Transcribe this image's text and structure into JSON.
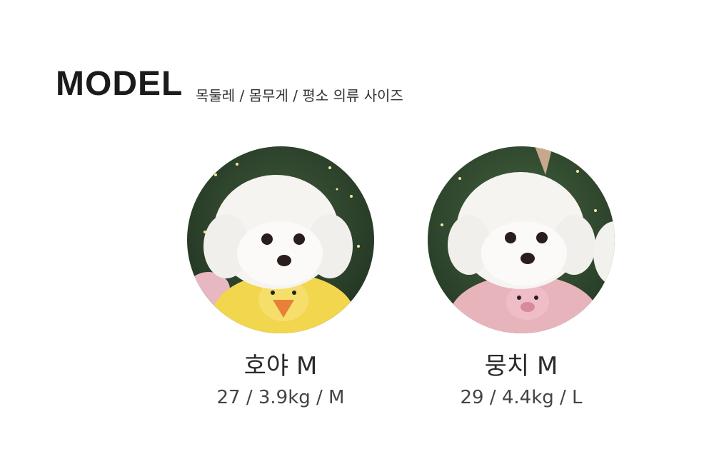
{
  "header": {
    "title": "MODEL",
    "subtitle": "목둘레  / 몸무게 / 평소 의류 사이즈"
  },
  "models": [
    {
      "name": "호야 M",
      "stats": "27 / 3.9kg / M",
      "outfit_color": "#f1d64e"
    },
    {
      "name": "뭉치 M",
      "stats": "29 / 4.4kg / L",
      "outfit_color": "#e8b4bc"
    }
  ]
}
